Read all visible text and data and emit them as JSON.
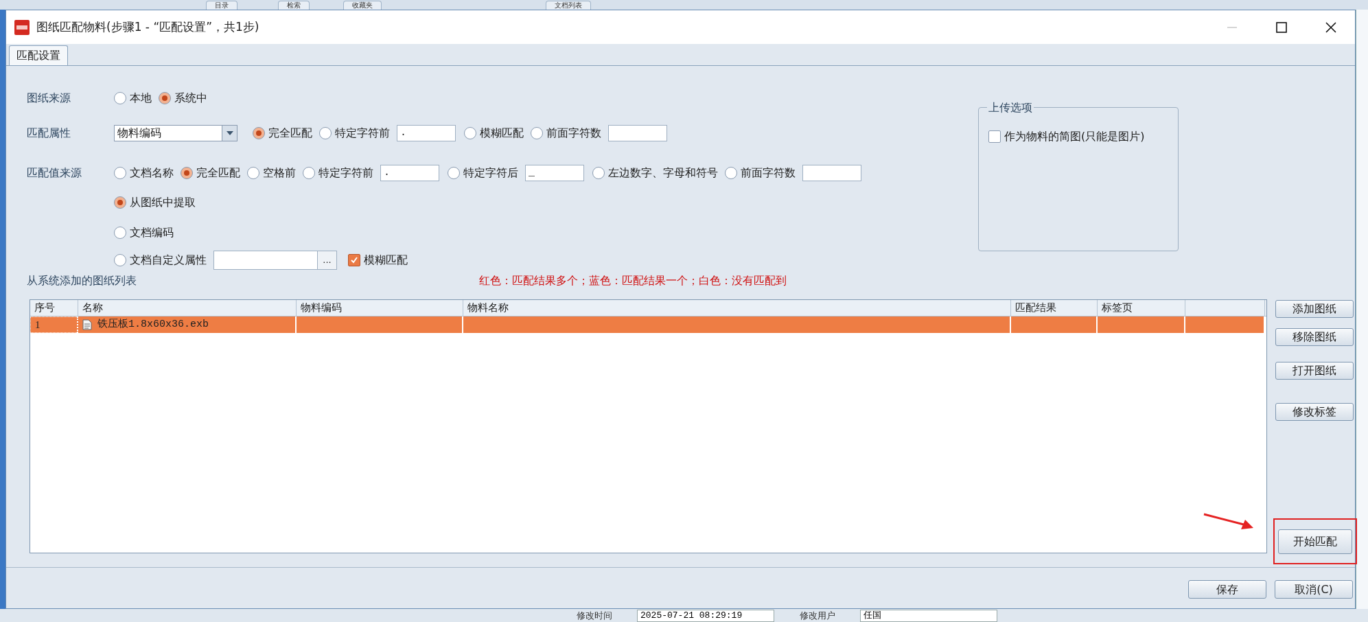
{
  "background_app": {
    "tabs": [
      {
        "label": "目录"
      },
      {
        "label": "检索"
      },
      {
        "label": "收藏夹"
      },
      {
        "label": "文档列表"
      }
    ],
    "footer": [
      {
        "label": "修改时间",
        "value": "2025-07-21 08:29:19"
      },
      {
        "label": "修改用户",
        "value": "任国"
      }
    ]
  },
  "window": {
    "title": "图纸匹配物料(步骤1 - “匹配设置”，共1步)"
  },
  "tabs": [
    {
      "label": "匹配设置",
      "selected": true
    }
  ],
  "settings": [
    {
      "label": "图纸来源",
      "lines": [
        [
          {
            "kind": "radio",
            "label": "本地",
            "selected": false
          },
          {
            "kind": "radio",
            "label": "系统中",
            "selected": true
          }
        ]
      ]
    },
    {
      "label": "匹配属性",
      "lines": [
        [
          {
            "kind": "select",
            "value": "物料编码"
          },
          {
            "kind": "radio",
            "label": "完全匹配",
            "selected": true
          },
          {
            "kind": "radio",
            "label": "特定字符前",
            "selected": false
          },
          {
            "kind": "input",
            "value": "."
          },
          {
            "kind": "radio",
            "label": "模糊匹配",
            "selected": false
          },
          {
            "kind": "radio",
            "label": "前面字符数",
            "selected": false
          },
          {
            "kind": "input"
          }
        ]
      ]
    },
    {
      "label": "匹配值来源",
      "lines": [
        [
          {
            "kind": "radio",
            "label": "文档名称",
            "selected": false
          },
          {
            "kind": "radio",
            "label": "完全匹配",
            "selected": true
          },
          {
            "kind": "radio",
            "label": "空格前",
            "selected": false
          },
          {
            "kind": "radio",
            "label": "特定字符前",
            "selected": false
          },
          {
            "kind": "input",
            "value": "."
          },
          {
            "kind": "radio",
            "label": "特定字符后",
            "selected": false
          },
          {
            "kind": "input",
            "value": "_"
          },
          {
            "kind": "radio",
            "label": "左边数字、字母和符号",
            "selected": false
          },
          {
            "kind": "radio",
            "label": "前面字符数",
            "selected": false
          },
          {
            "kind": "input"
          }
        ],
        [
          {
            "kind": "radio",
            "label": "从图纸中提取",
            "selected": true
          }
        ],
        [
          {
            "kind": "radio",
            "label": "文档编码",
            "selected": false
          }
        ],
        [
          {
            "kind": "radio",
            "label": "文档自定义属性",
            "selected": false
          },
          {
            "kind": "picker",
            "button": "..."
          },
          {
            "kind": "checkbox",
            "label": "模糊匹配",
            "checked": true
          }
        ]
      ]
    }
  ],
  "upload_options": {
    "title": "上传选项",
    "options": [
      {
        "label": "作为物料的简图(只能是图片)",
        "checked": false
      }
    ]
  },
  "list": {
    "title": "从系统添加的图纸列表",
    "legend": "红色：匹配结果多个；蓝色：匹配结果一个；白色：没有匹配到",
    "columns": [
      "序号",
      "名称",
      "物料编码",
      "物料名称",
      "匹配结果",
      "标签页"
    ],
    "rows": [
      {
        "index": "1",
        "name": "铁压板1.8x60x36.exb",
        "color": "#ee7d44"
      }
    ]
  },
  "side_buttons": [
    "添加图纸",
    "移除图纸",
    "打开图纸",
    "修改标签"
  ],
  "start_button": {
    "label": "开始匹配",
    "highlighted": true
  },
  "footer_buttons": [
    "保存",
    "取消(C)"
  ]
}
